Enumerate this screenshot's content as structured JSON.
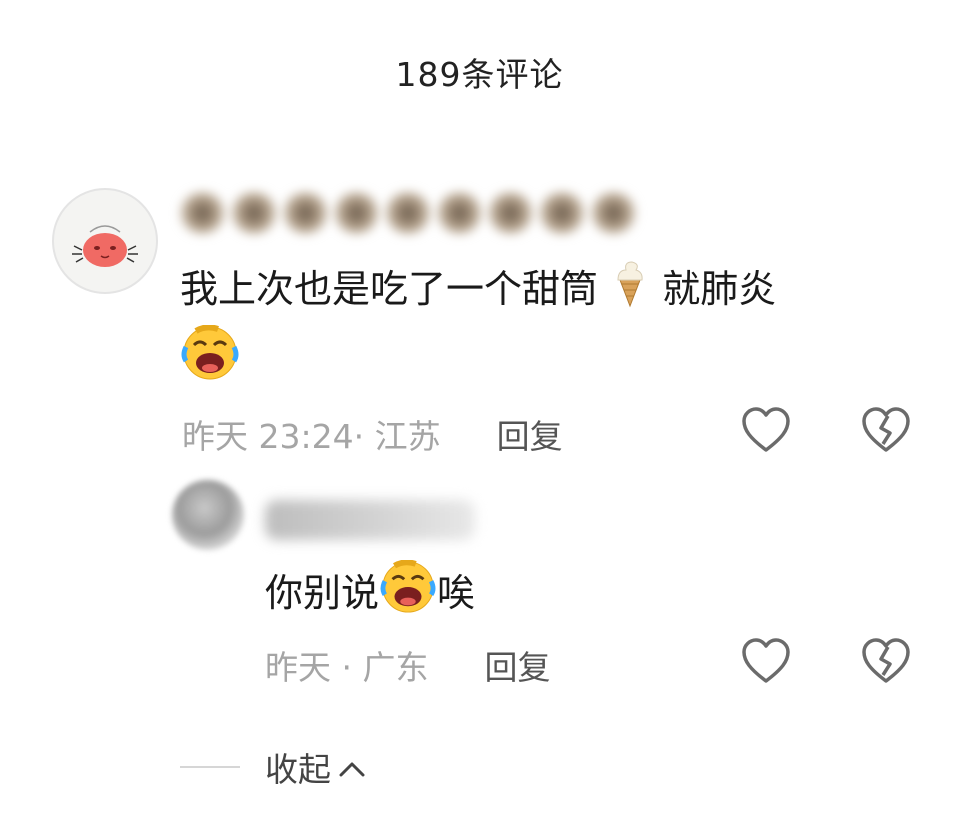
{
  "header": {
    "title": "189条评论"
  },
  "comment": {
    "text_part1": "我上次也是吃了一个甜筒",
    "text_part2": "就肺炎",
    "time_location": "昨天 23:24· 江苏",
    "reply_label": "回复",
    "emojis": [
      "ice-cream",
      "laugh-cry"
    ]
  },
  "reply": {
    "text_part1": "你别说",
    "text_part2": "唉",
    "time_location": "昨天 · 广东",
    "reply_label": "回复",
    "emojis": [
      "laugh-cry"
    ]
  },
  "collapse": {
    "label": "收起"
  },
  "colors": {
    "muted": "#a5a5a5",
    "icon": "#6b6b6b",
    "text": "#1a1a1a"
  }
}
